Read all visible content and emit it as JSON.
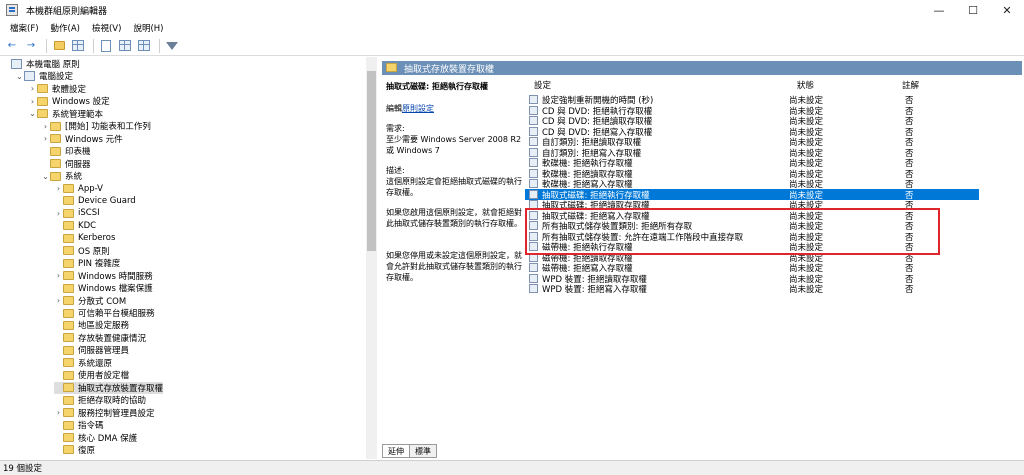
{
  "window": {
    "title": "本機群組原則編輯器",
    "min": "—",
    "max": "☐",
    "close": "✕"
  },
  "menu": [
    "檔案(F)",
    "動作(A)",
    "檢視(V)",
    "說明(H)"
  ],
  "toolbar": {
    "back": "←",
    "forward": "→"
  },
  "tree": [
    {
      "label": "本機電腦 原則",
      "level": 0,
      "exp": "",
      "icon": "gpo"
    },
    {
      "label": "電腦設定",
      "level": 1,
      "exp": "⌄",
      "icon": "gpo"
    },
    {
      "label": "軟體設定",
      "level": 2,
      "exp": "›",
      "icon": "folder"
    },
    {
      "label": "Windows 設定",
      "level": 2,
      "exp": "›",
      "icon": "folder"
    },
    {
      "label": "系統管理範本",
      "level": 2,
      "exp": "⌄",
      "icon": "folder"
    },
    {
      "label": "[開始] 功能表和工作列",
      "level": 3,
      "exp": "›",
      "icon": "folder"
    },
    {
      "label": "Windows 元件",
      "level": 3,
      "exp": "›",
      "icon": "folder"
    },
    {
      "label": "印表機",
      "level": 3,
      "exp": "",
      "icon": "folder"
    },
    {
      "label": "伺服器",
      "level": 3,
      "exp": "",
      "icon": "folder"
    },
    {
      "label": "系統",
      "level": 3,
      "exp": "⌄",
      "icon": "folder"
    },
    {
      "label": "App-V",
      "level": 4,
      "exp": "›",
      "icon": "folder"
    },
    {
      "label": "Device Guard",
      "level": 4,
      "exp": "",
      "icon": "folder"
    },
    {
      "label": "iSCSI",
      "level": 4,
      "exp": "›",
      "icon": "folder"
    },
    {
      "label": "KDC",
      "level": 4,
      "exp": "",
      "icon": "folder"
    },
    {
      "label": "Kerberos",
      "level": 4,
      "exp": "",
      "icon": "folder"
    },
    {
      "label": "OS 原則",
      "level": 4,
      "exp": "",
      "icon": "folder"
    },
    {
      "label": "PIN 複雜度",
      "level": 4,
      "exp": "",
      "icon": "folder"
    },
    {
      "label": "Windows 時間服務",
      "level": 4,
      "exp": "›",
      "icon": "folder"
    },
    {
      "label": "Windows 檔案保護",
      "level": 4,
      "exp": "",
      "icon": "folder"
    },
    {
      "label": "分散式 COM",
      "level": 4,
      "exp": "›",
      "icon": "folder"
    },
    {
      "label": "可信賴平台模組服務",
      "level": 4,
      "exp": "",
      "icon": "folder"
    },
    {
      "label": "地區設定服務",
      "level": 4,
      "exp": "",
      "icon": "folder"
    },
    {
      "label": "存放裝置健康情況",
      "level": 4,
      "exp": "",
      "icon": "folder"
    },
    {
      "label": "伺服器管理員",
      "level": 4,
      "exp": "",
      "icon": "folder"
    },
    {
      "label": "系統還原",
      "level": 4,
      "exp": "",
      "icon": "folder"
    },
    {
      "label": "使用者設定檔",
      "level": 4,
      "exp": "",
      "icon": "folder"
    },
    {
      "label": "抽取式存放裝置存取權",
      "level": 4,
      "exp": "",
      "icon": "folder",
      "selected": true
    },
    {
      "label": "拒絕存取時的協助",
      "level": 4,
      "exp": "",
      "icon": "folder"
    },
    {
      "label": "服務控制管理員設定",
      "level": 4,
      "exp": "›",
      "icon": "folder"
    },
    {
      "label": "指令碼",
      "level": 4,
      "exp": "",
      "icon": "folder"
    },
    {
      "label": "核心 DMA 保護",
      "level": 4,
      "exp": "",
      "icon": "folder"
    },
    {
      "label": "復原",
      "level": 4,
      "exp": "",
      "icon": "folder"
    }
  ],
  "right": {
    "header": "抽取式存放裝置存取權",
    "policy_title": "抽取式磁碟: 拒絕執行存取權",
    "edit_prefix": "編輯",
    "edit_link": "原則設定",
    "req_label": "需求:",
    "req_text": "至少需要 Windows Server 2008 R2 或 Windows 7",
    "desc_label": "描述:",
    "desc_text": "這個原則設定會拒絕抽取式磁碟的執行存取權。",
    "enable_text": "如果您啟用這個原則設定，就會拒絕對此抽取式儲存裝置類別的執行存取權。",
    "disable_text": "如果您停用或未設定這個原則設定，就會允許對此抽取式儲存裝置類別的執行存取權。",
    "columns": {
      "setting": "設定",
      "state": "狀態",
      "comment": "註解"
    },
    "rows": [
      {
        "name": "設定強制重新開機的時間 (秒)",
        "state": "尚未設定",
        "comment": "否"
      },
      {
        "name": "CD 與 DVD: 拒絕執行存取權",
        "state": "尚未設定",
        "comment": "否"
      },
      {
        "name": "CD 與 DVD: 拒絕讀取存取權",
        "state": "尚未設定",
        "comment": "否"
      },
      {
        "name": "CD 與 DVD: 拒絕寫入存取權",
        "state": "尚未設定",
        "comment": "否"
      },
      {
        "name": "自訂類別: 拒絕讀取存取權",
        "state": "尚未設定",
        "comment": "否"
      },
      {
        "name": "自訂類別: 拒絕寫入存取權",
        "state": "尚未設定",
        "comment": "否"
      },
      {
        "name": "軟碟機: 拒絕執行存取權",
        "state": "尚未設定",
        "comment": "否"
      },
      {
        "name": "軟碟機: 拒絕讀取存取權",
        "state": "尚未設定",
        "comment": "否"
      },
      {
        "name": "軟碟機: 拒絕寫入存取權",
        "state": "尚未設定",
        "comment": "否"
      },
      {
        "name": "抽取式磁碟: 拒絕執行存取權",
        "state": "尚未設定",
        "comment": "否",
        "selected": true
      },
      {
        "name": "抽取式磁碟: 拒絕讀取存取權",
        "state": "尚未設定",
        "comment": "否"
      },
      {
        "name": "抽取式磁碟: 拒絕寫入存取權",
        "state": "尚未設定",
        "comment": "否"
      },
      {
        "name": "所有抽取式儲存裝置類別: 拒絕所有存取",
        "state": "尚未設定",
        "comment": "否"
      },
      {
        "name": "所有抽取式儲存裝置: 允許在遠端工作階段中直接存取",
        "state": "尚未設定",
        "comment": "否"
      },
      {
        "name": "磁帶機: 拒絕執行存取權",
        "state": "尚未設定",
        "comment": "否"
      },
      {
        "name": "磁帶機: 拒絕讀取存取權",
        "state": "尚未設定",
        "comment": "否"
      },
      {
        "name": "磁帶機: 拒絕寫入存取權",
        "state": "尚未設定",
        "comment": "否"
      },
      {
        "name": "WPD 裝置: 拒絕讀取存取權",
        "state": "尚未設定",
        "comment": "否"
      },
      {
        "name": "WPD 裝置: 拒絕寫入存取權",
        "state": "尚未設定",
        "comment": "否"
      }
    ]
  },
  "tabs": [
    "延伸",
    "標準"
  ],
  "status": "19 個設定"
}
